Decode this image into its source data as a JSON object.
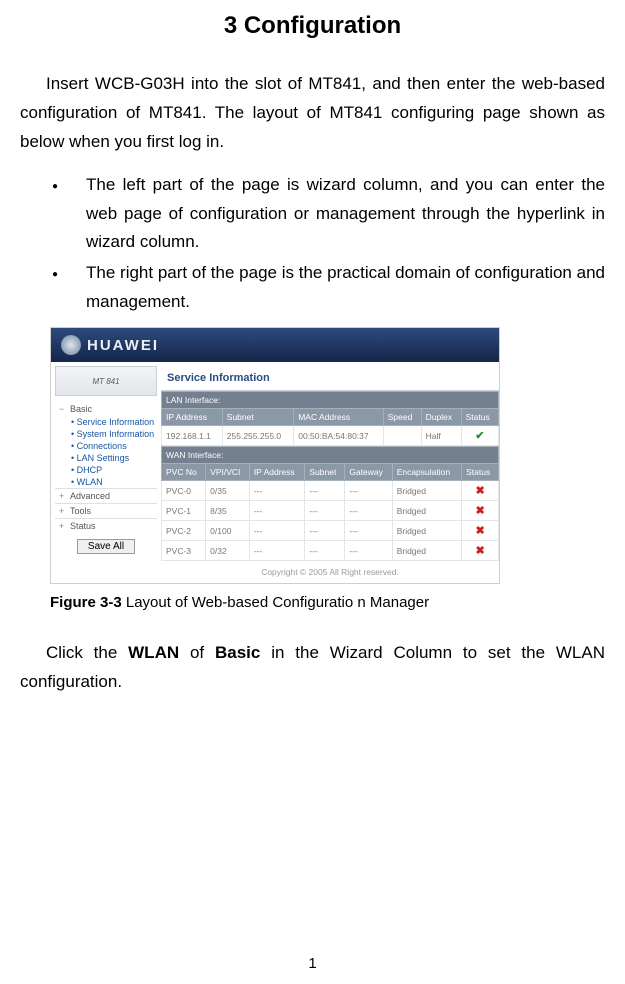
{
  "title": "3  Configuration",
  "intro_para": "Insert WCB-G03H into the slot of MT841, and then enter the web-based configuration of MT841. The layout of MT841 configuring page shown as below when you first log in.",
  "bullets": [
    "The left part of the page is wizard column, and you can enter the web page of configuration or management through the hyperlink in wizard column.",
    "The right part of the page is the practical domain of configuration and management."
  ],
  "after_para_1": "Click the ",
  "after_b1": "WLAN",
  "after_mid": " of ",
  "after_b2": "Basic",
  "after_tail": " in the Wizard Column to set the WLAN configuration.",
  "figcap_label": "Figure 3-3",
  "figcap_text": "  Layout of Web-based Configuratio n Manager",
  "pagenum": "1",
  "screenshot": {
    "brand": "HUAWEI",
    "device": "MT 841",
    "section_title": "Service Information",
    "sidebar": {
      "groups": [
        {
          "icon": "−",
          "label": "Basic"
        },
        {
          "icon": "+",
          "label": "Advanced"
        },
        {
          "icon": "+",
          "label": "Tools"
        },
        {
          "icon": "+",
          "label": "Status"
        }
      ],
      "basic_subs": [
        "Service Information",
        "System Information",
        "Connections",
        "LAN Settings",
        "DHCP",
        "WLAN"
      ],
      "save_btn": "Save All"
    },
    "lan_header": "LAN Interface:",
    "lan_cols": [
      "IP Address",
      "Subnet",
      "MAC Address",
      "Speed",
      "Duplex",
      "Status"
    ],
    "lan_row": {
      "ip": "192.168.1.1",
      "subnet": "255.255.255.0",
      "mac": "00:50:BA:54:80:37",
      "speed": "",
      "duplex": "Half",
      "status": "ok"
    },
    "wan_header": "WAN Interface:",
    "wan_cols": [
      "PVC No",
      "VPI/VCI",
      "IP Address",
      "Subnet",
      "Gateway",
      "Encapsulation",
      "Status"
    ],
    "wan_rows": [
      {
        "pvc": "PVC-0",
        "vpi": "0/35",
        "ip": "---",
        "subnet": "---",
        "gw": "---",
        "enc": "Bridged",
        "status": "x"
      },
      {
        "pvc": "PVC-1",
        "vpi": "8/35",
        "ip": "---",
        "subnet": "---",
        "gw": "---",
        "enc": "Bridged",
        "status": "x"
      },
      {
        "pvc": "PVC-2",
        "vpi": "0/100",
        "ip": "---",
        "subnet": "---",
        "gw": "---",
        "enc": "Bridged",
        "status": "x"
      },
      {
        "pvc": "PVC-3",
        "vpi": "0/32",
        "ip": "---",
        "subnet": "---",
        "gw": "---",
        "enc": "Bridged",
        "status": "x"
      }
    ],
    "footer": "Copyright © 2005 All Right reserved."
  }
}
